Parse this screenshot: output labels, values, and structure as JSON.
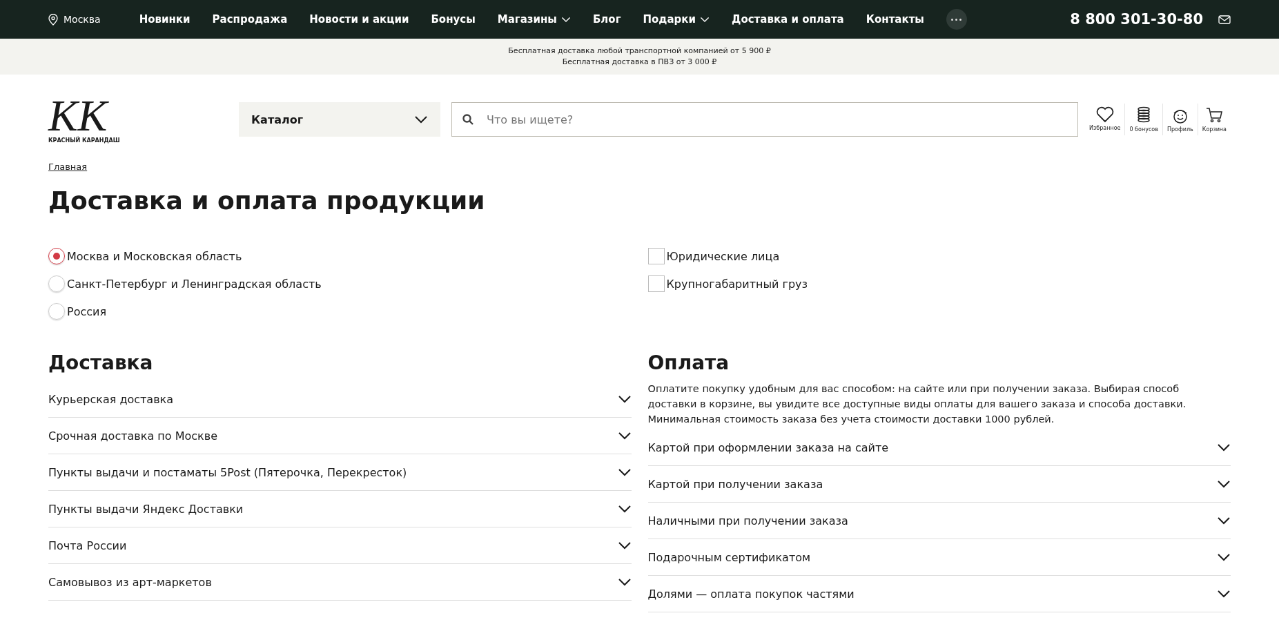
{
  "top_bar": {
    "city": "Москва",
    "nav": [
      {
        "label": "Новинки",
        "dropdown": false
      },
      {
        "label": "Распродажа",
        "dropdown": false
      },
      {
        "label": "Новости и акции",
        "dropdown": false
      },
      {
        "label": "Бонусы",
        "dropdown": false
      },
      {
        "label": "Магазины",
        "dropdown": true
      },
      {
        "label": "Блог",
        "dropdown": false
      },
      {
        "label": "Подарки",
        "dropdown": true
      },
      {
        "label": "Доставка и оплата",
        "dropdown": false
      },
      {
        "label": "Контакты",
        "dropdown": false
      }
    ],
    "phone": "8 800 301-30-80"
  },
  "promo": [
    "Бесплатная доставка любой транспортной компанией от 5 900 ₽",
    "Бесплатная доставка в ПВЗ от 3 000 ₽"
  ],
  "header": {
    "logo_mark": "КК",
    "logo_text": "КРАСНЫЙ КАРАНДАШ",
    "catalog": "Каталог",
    "search_placeholder": "Что вы ищете?",
    "actions": [
      {
        "kind": "heart",
        "label": "Избранное"
      },
      {
        "kind": "coins",
        "label": "0 бонусов"
      },
      {
        "kind": "profile",
        "label": "Профиль"
      },
      {
        "kind": "cart",
        "label": "Корзина"
      }
    ]
  },
  "breadcrumb": "Главная",
  "title": "Доставка и оплата продукции",
  "regions": [
    {
      "label": "Москва и Московская область",
      "selected": true
    },
    {
      "label": "Санкт-Петербург и Ленинградская область",
      "selected": false
    },
    {
      "label": "Россия",
      "selected": false
    }
  ],
  "filters": [
    {
      "label": "Юридические лица",
      "checked": false
    },
    {
      "label": "Крупногабаритный груз",
      "checked": false
    }
  ],
  "delivery": {
    "heading": "Доставка",
    "items": [
      {
        "label": "Курьерская доставка",
        "expanded": false
      },
      {
        "label": "Срочная доставка по Москве",
        "expanded": false
      },
      {
        "label": "Пункты выдачи и постаматы 5Post (Пятерочка, Перекресток)",
        "expanded": false
      },
      {
        "label": "Пункты выдачи Яндекс Доставки",
        "expanded": false
      },
      {
        "label": "Почта России",
        "expanded": false
      },
      {
        "label": "Самовывоз из арт-маркетов",
        "expanded": false
      }
    ]
  },
  "payment": {
    "heading": "Оплата",
    "intro": "Оплатите покупку удобным для вас способом: на сайте или при получении заказа. Выбирая способ доставки в корзине, вы увидите все доступные виды оплаты для вашего заказа и способа доставки. Минимальная стоимость заказа без учета стоимости доставки 1000 рублей.",
    "items": [
      {
        "label": "Картой при оформлении заказа на сайте",
        "expanded": false
      },
      {
        "label": "Картой при получении заказа",
        "expanded": false
      },
      {
        "label": "Наличными при получении заказа",
        "expanded": false
      },
      {
        "label": "Подарочным сертификатом",
        "expanded": false
      },
      {
        "label": "Долями — оплата покупок частями",
        "expanded": false
      }
    ]
  }
}
